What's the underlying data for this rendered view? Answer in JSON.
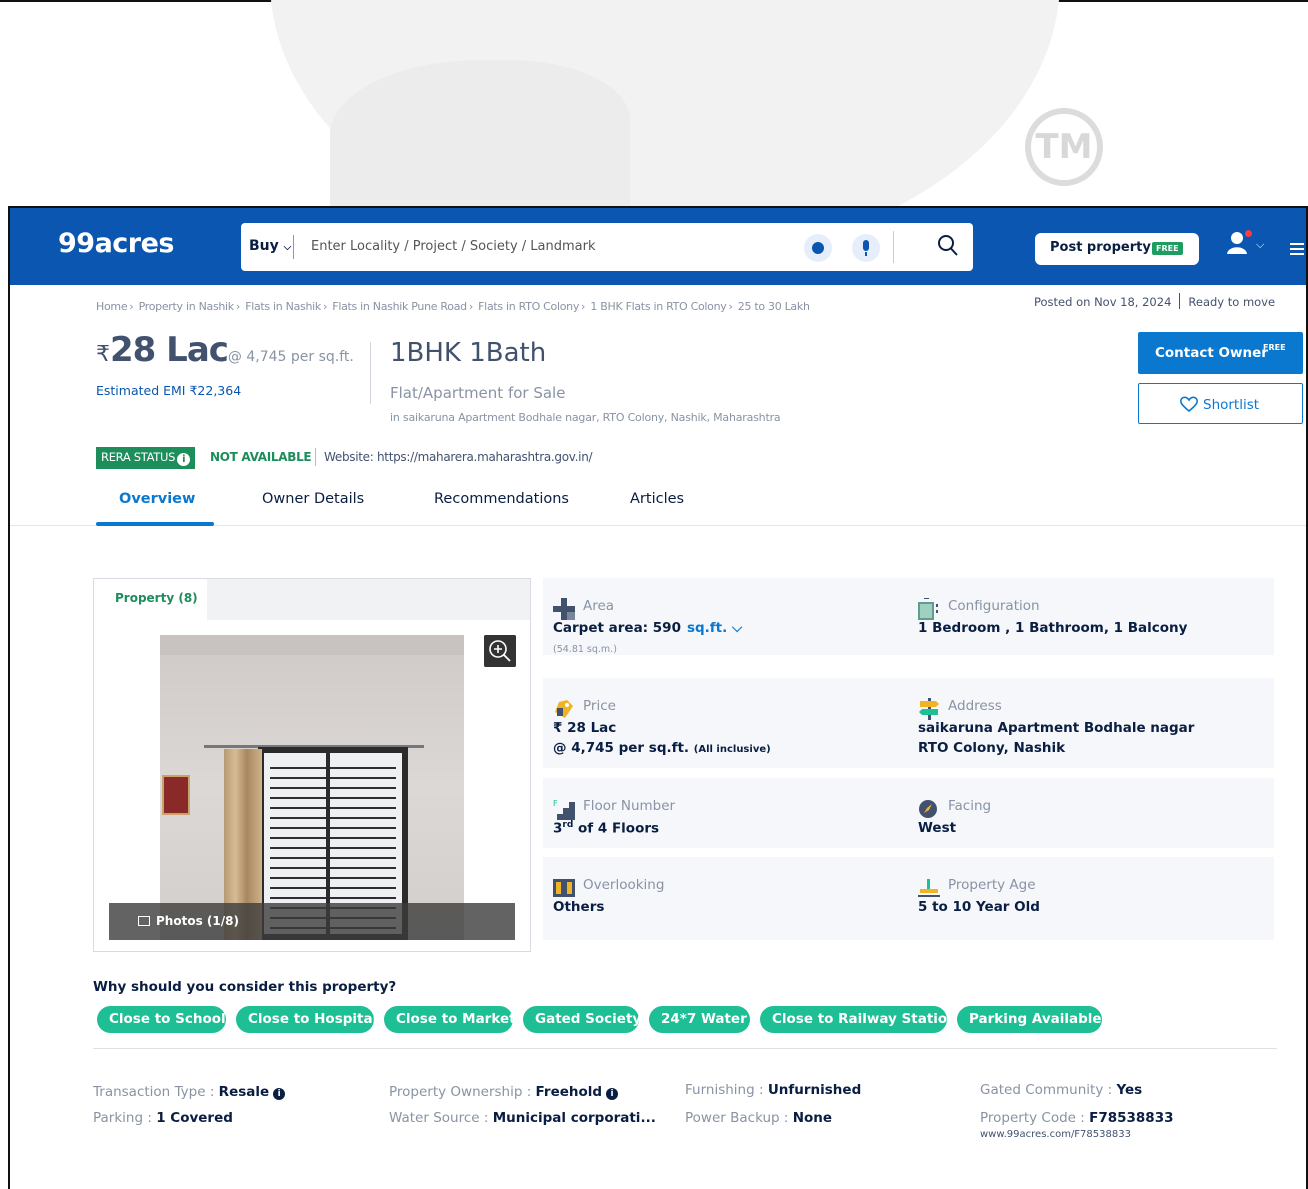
{
  "watermark": {
    "tm": "TM"
  },
  "header": {
    "logo": "99acres",
    "buy_label": "Buy",
    "search_placeholder": "Enter Locality / Project / Society / Landmark",
    "post_property": "Post property",
    "post_free": "FREE",
    "brand_color": "#0a56b0"
  },
  "breadcrumb": [
    "Home",
    "Property in Nashik",
    "Flats in Nashik",
    "Flats in Nashik Pune Road",
    "Flats in RTO Colony",
    "1 BHK Flats in RTO Colony",
    "25 to 30 Lakh"
  ],
  "meta": {
    "posted": "Posted on Nov 18, 2024",
    "status": "Ready to move"
  },
  "listing": {
    "rupee": "₹",
    "price": "28 Lac",
    "per_sqft": "@ 4,745 per sq.ft.",
    "emi": "Estimated EMI ₹22,364",
    "title": "1BHK 1Bath",
    "subtitle": "Flat/Apartment for Sale",
    "address": "in saikaruna Apartment Bodhale nagar, RTO Colony, Nashik, Maharashtra"
  },
  "actions": {
    "contact": "Contact Owner",
    "contact_free": "FREE",
    "shortlist": "Shortlist"
  },
  "rera": {
    "badge": "RERA STATUS",
    "status": "NOT AVAILABLE",
    "website": "Website: https://maharera.maharashtra.gov.in/"
  },
  "tabs": [
    "Overview",
    "Owner Details",
    "Recommendations",
    "Articles"
  ],
  "photos": {
    "tab": "Property (8)",
    "count": "Photos (1/8)"
  },
  "details": {
    "area": {
      "label": "Area",
      "value": "Carpet area: 590",
      "unit": "sq.ft.",
      "sub": "(54.81 sq.m.)"
    },
    "configuration": {
      "label": "Configuration",
      "value": "1 Bedroom , 1 Bathroom, 1 Balcony"
    },
    "price": {
      "label": "Price",
      "value": "₹ 28 Lac",
      "value2": "@ 4,745 per sq.ft.",
      "note": "(All inclusive)"
    },
    "address": {
      "label": "Address",
      "value": "saikaruna Apartment Bodhale nagar",
      "value2": "RTO Colony, Nashik"
    },
    "floor": {
      "label": "Floor Number",
      "value_num": "3",
      "value_sup": "rd",
      "value_rest": "of 4 Floors"
    },
    "facing": {
      "label": "Facing",
      "value": "West"
    },
    "overlooking": {
      "label": "Overlooking",
      "value": "Others"
    },
    "age": {
      "label": "Property Age",
      "value": "5 to 10 Year Old"
    }
  },
  "why": {
    "heading": "Why should you consider this property?",
    "chips": [
      "Close to School",
      "Close to Hospital",
      "Close to Market",
      "Gated Society",
      "24*7 Water",
      "Close to Railway Station",
      "Parking Available"
    ]
  },
  "summary": {
    "transaction_label": "Transaction Type : ",
    "transaction": "Resale",
    "parking_label": "Parking : ",
    "parking": "1 Covered",
    "ownership_label": "Property Ownership : ",
    "ownership": "Freehold",
    "water_label": "Water Source : ",
    "water": "Municipal corporati...",
    "furnishing_label": "Furnishing : ",
    "furnishing": "Unfurnished",
    "backup_label": "Power Backup : ",
    "backup": "None",
    "gated_label": "Gated Community : ",
    "gated": "Yes",
    "code_label": "Property Code : ",
    "code": "F78538833",
    "url": "www.99acres.com/F78538833"
  }
}
